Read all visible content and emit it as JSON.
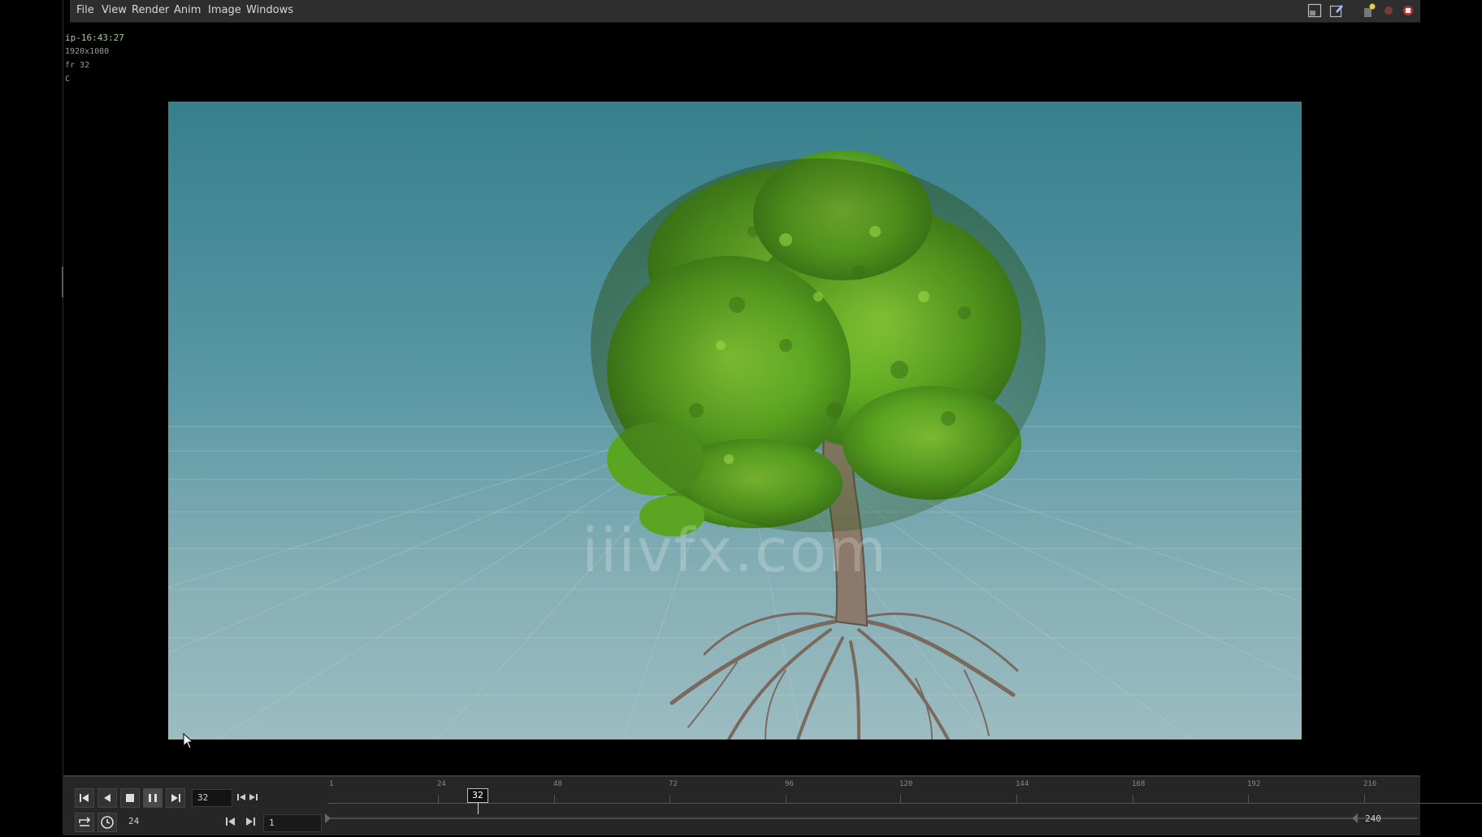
{
  "menu": {
    "items": [
      {
        "label": "File"
      },
      {
        "label": "View"
      },
      {
        "label": "Render"
      },
      {
        "label": "Anim"
      },
      {
        "label": "Image"
      },
      {
        "label": "Windows"
      }
    ]
  },
  "hud": {
    "time": "ip-16:43:27",
    "resolution": "1920x1080",
    "frame": "fr 32",
    "channel": "C"
  },
  "viewport": {
    "watermark": "iiivfx.com"
  },
  "timeline": {
    "current_frame": "32",
    "fps": "24",
    "range_start": "1",
    "range_end": "240",
    "ruler_labels": [
      "1",
      "24",
      "48",
      "72",
      "96",
      "120",
      "144",
      "168",
      "192",
      "216"
    ],
    "current_frame_marker": "32"
  },
  "colors": {
    "menubar_bg": "#2e2e2e",
    "hud_time": "#9ad38a",
    "sky_top": "#377f8c",
    "sky_bottom": "#9bbcc1"
  }
}
